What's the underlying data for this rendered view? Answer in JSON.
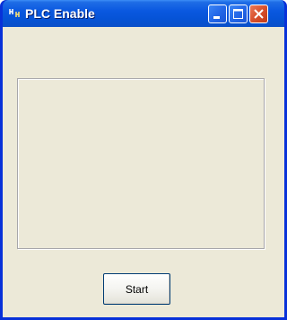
{
  "window": {
    "title": "PLC Enable",
    "icon": "plc-network-icon",
    "controls": {
      "minimize_icon": "minimize-icon",
      "maximize_icon": "maximize-icon",
      "close_icon": "close-icon"
    }
  },
  "main": {
    "output_panel_text": "",
    "start_label": "Start"
  },
  "colors": {
    "titlebar": "#0a58e0",
    "client_background": "#ece9d8",
    "close_button": "#d8502d"
  }
}
